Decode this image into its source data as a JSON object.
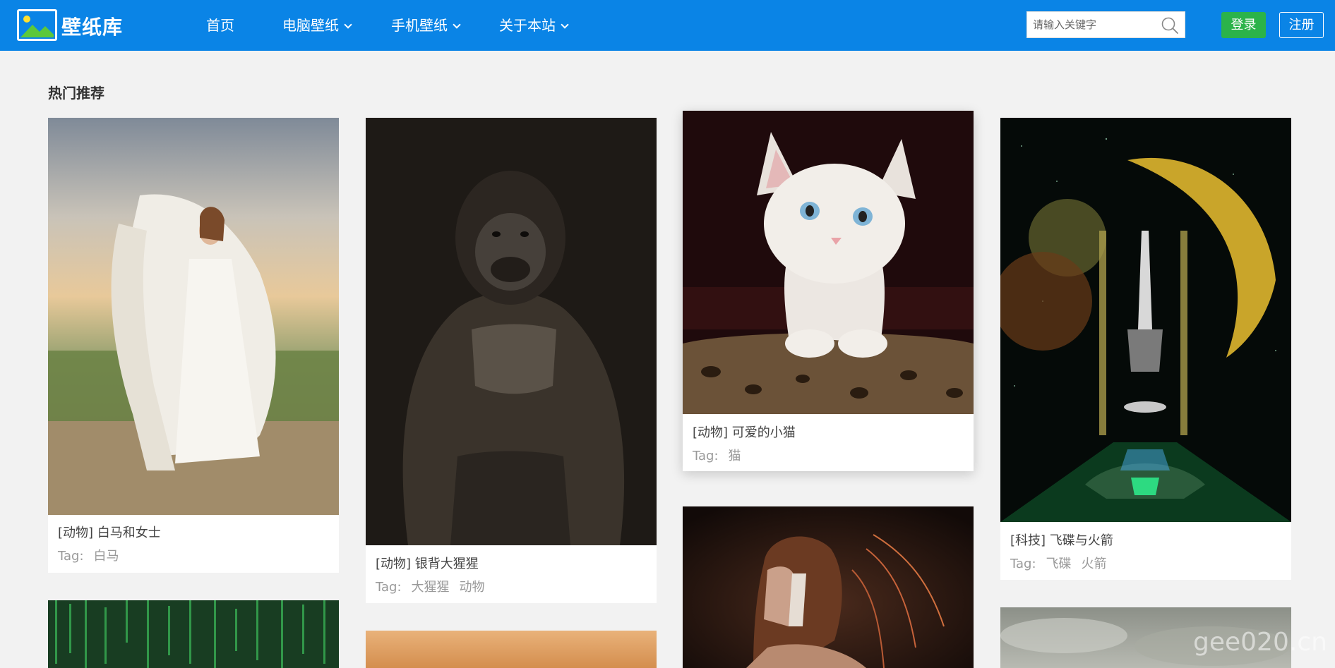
{
  "header": {
    "logo_text": "壁纸库",
    "nav": [
      {
        "label": "首页"
      },
      {
        "label": "电脑壁纸"
      },
      {
        "label": "手机壁纸"
      },
      {
        "label": "关于本站"
      }
    ],
    "search_placeholder": "请输入关键字",
    "login_label": "登录",
    "register_label": "注册",
    "brand_color": "#0a84e6",
    "login_color": "#2bb34a"
  },
  "main": {
    "section_title": "热门推荐",
    "tag_prefix": "Tag:",
    "cards": [
      {
        "title": "[动物] 白马和女士",
        "tags": [
          "白马"
        ],
        "image": "woman-with-white-horse"
      },
      {
        "title": "[动物] 银背大猩猩",
        "tags": [
          "大猩猩",
          "动物"
        ],
        "image": "silverback-gorilla"
      },
      {
        "title": "[动物] 可爱的小猫",
        "tags": [
          "猫"
        ],
        "image": "white-kitten"
      },
      {
        "title": "[科技] 飞碟与火箭",
        "tags": [
          "飞碟",
          "火箭"
        ],
        "image": "ufo-and-rocket"
      },
      {
        "image": "green-matrix"
      },
      {
        "image": "desert-sand"
      },
      {
        "image": "woman-with-mask"
      },
      {
        "image": "cloudy-sky"
      }
    ]
  },
  "watermark": "gee020.cn"
}
